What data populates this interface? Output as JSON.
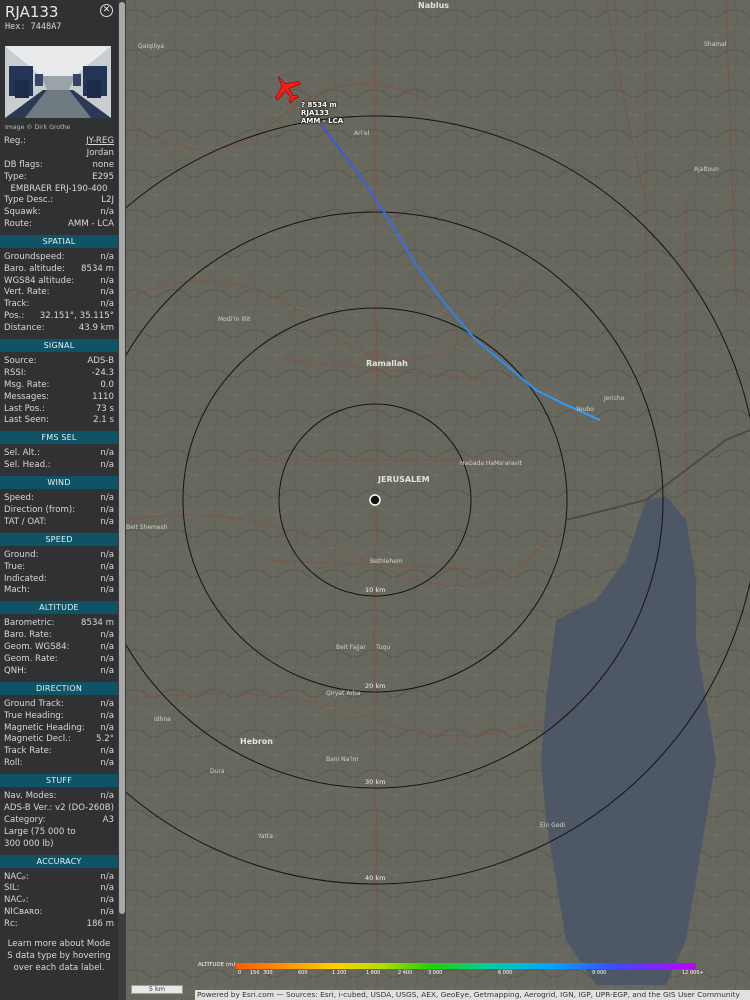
{
  "aircraft": {
    "callsign": "RJA133",
    "hex_label": "Hex:",
    "hex": "7448A7",
    "close_glyph": "✕",
    "photo_credit": "Image © Dirk Grothe"
  },
  "info_rows": [
    {
      "label": "Reg.:",
      "value": "JY-REG",
      "link": true
    },
    {
      "label": "",
      "value": "Jordan"
    },
    {
      "label": "DB flags:",
      "value": "none"
    },
    {
      "label": "Type:",
      "value": "E295"
    },
    {
      "label": "",
      "value": "EMBRAER ERJ-190-400",
      "center": true
    },
    {
      "label": "Type Desc.:",
      "value": "L2J"
    },
    {
      "label": "Squawk:",
      "value": "n/a"
    },
    {
      "label": "Route:",
      "value": "AMM - LCA"
    }
  ],
  "sections": [
    {
      "title": "SPATIAL",
      "rows": [
        {
          "label": "Groundspeed:",
          "value": "n/a"
        },
        {
          "label": "Baro. altitude:",
          "value": "8534 m"
        },
        {
          "label": "WGS84 altitude:",
          "value": "n/a"
        },
        {
          "label": "Vert. Rate:",
          "value": "n/a"
        },
        {
          "label": "Track:",
          "value": "n/a"
        },
        {
          "label": "Pos.:",
          "value": "32.151°, 35.115°"
        },
        {
          "label": "Distance:",
          "value": "43.9 km"
        }
      ]
    },
    {
      "title": "SIGNAL",
      "rows": [
        {
          "label": "Source:",
          "value": "ADS-B"
        },
        {
          "label": "RSSI:",
          "value": "-24.3"
        },
        {
          "label": "Msg. Rate:",
          "value": "0.0"
        },
        {
          "label": "Messages:",
          "value": "1110"
        },
        {
          "label": "Last Pos.:",
          "value": "73 s"
        },
        {
          "label": "Last Seen:",
          "value": "2.1 s"
        }
      ]
    },
    {
      "title": "FMS SEL",
      "rows": [
        {
          "label": "Sel. Alt.:",
          "value": "n/a"
        },
        {
          "label": "Sel. Head.:",
          "value": "n/a"
        }
      ]
    },
    {
      "title": "WIND",
      "rows": [
        {
          "label": "Speed:",
          "value": "n/a"
        },
        {
          "label": "Direction (from):",
          "value": "n/a"
        },
        {
          "label": "TAT / OAT:",
          "value": "n/a"
        }
      ]
    },
    {
      "title": "SPEED",
      "rows": [
        {
          "label": "Ground:",
          "value": "n/a"
        },
        {
          "label": "True:",
          "value": "n/a"
        },
        {
          "label": "Indicated:",
          "value": "n/a"
        },
        {
          "label": "Mach:",
          "value": "n/a"
        }
      ]
    },
    {
      "title": "ALTITUDE",
      "rows": [
        {
          "label": "Barometric:",
          "value": "8534 m"
        },
        {
          "label": "Baro. Rate:",
          "value": "n/a"
        },
        {
          "label": "Geom. WGS84:",
          "value": "n/a"
        },
        {
          "label": "Geom. Rate:",
          "value": "n/a"
        },
        {
          "label": "QNH:",
          "value": "n/a"
        }
      ]
    },
    {
      "title": "DIRECTION",
      "rows": [
        {
          "label": "Ground Track:",
          "value": "n/a"
        },
        {
          "label": "True Heading:",
          "value": "n/a"
        },
        {
          "label": "Magnetic Heading:",
          "value": "n/a"
        },
        {
          "label": "Magnetic Decl.:",
          "value": "5.2°"
        },
        {
          "label": "Track Rate:",
          "value": "n/a"
        },
        {
          "label": "Roll:",
          "value": "n/a"
        }
      ]
    },
    {
      "title": "STUFF",
      "rows": [
        {
          "label": "Nav. Modes:",
          "value": "n/a"
        },
        {
          "label": "ADS-B Ver.:",
          "value": "v2 (DO-260B)"
        },
        {
          "label": "Category:",
          "value": "A3"
        },
        {
          "label": "Large (75 000 to",
          "value": ""
        },
        {
          "label": "300 000 lb)",
          "value": ""
        }
      ]
    },
    {
      "title": "ACCURACY",
      "rows": [
        {
          "label": "NACₚ:",
          "value": "n/a"
        },
        {
          "label": "SIL:",
          "value": "n/a"
        },
        {
          "label": "NACᵥ:",
          "value": "n/a"
        },
        {
          "label": "NICʙᴀʀᴏ:",
          "value": "n/a"
        },
        {
          "label": "Rᴄ:",
          "value": "186 m"
        }
      ]
    }
  ],
  "footer_text": "Learn more about Mode S data type by hovering over each data label.",
  "map": {
    "aircraft_label": {
      "line1": "?  8534 m",
      "line2": "RJA133",
      "line3": "AMM - LCA"
    },
    "aircraft_color": "#ff1a1a",
    "ring_labels": [
      "10 km",
      "20 km",
      "30 km",
      "40 km"
    ],
    "places": [
      {
        "name": "Nablus",
        "big": true
      },
      {
        "name": "Qalqiliya"
      },
      {
        "name": "Ramallah",
        "big": true
      },
      {
        "name": "JERUSALEM",
        "big": true
      },
      {
        "name": "Bethlehem"
      },
      {
        "name": "Hebron"
      },
      {
        "name": "Jericho"
      },
      {
        "name": "Ari'el"
      },
      {
        "name": "Modi'in Illit"
      },
      {
        "name": "HaGada HaMa'aravit"
      },
      {
        "name": "Beit Shemesh"
      },
      {
        "name": "Qiryat Arba"
      },
      {
        "name": "Yatta"
      },
      {
        "name": "Shamal"
      },
      {
        "name": "Ajaltoun"
      },
      {
        "name": "Yeubo"
      },
      {
        "name": "Dura"
      },
      {
        "name": "Idhna"
      },
      {
        "name": "Beit Fajjar"
      },
      {
        "name": "Tuqu"
      },
      {
        "name": "Bani Na'im"
      },
      {
        "name": "Ein Gedi"
      }
    ],
    "legend_title": "ALTITUDE (m)",
    "legend_ticks": [
      "0",
      "150",
      "300",
      "600",
      "1 200",
      "1 800",
      "2 400",
      "3 000",
      "6 000",
      "9 000",
      "12 000+"
    ],
    "scale_label": "5 km",
    "attribution": "Powered by Esri.com — Sources: Esri, i-cubed, USDA, USGS, AEX, GeoEye, Getmapping, Aerogrid, IGN, IGP, UPR-EGP, and the GIS User Community"
  }
}
